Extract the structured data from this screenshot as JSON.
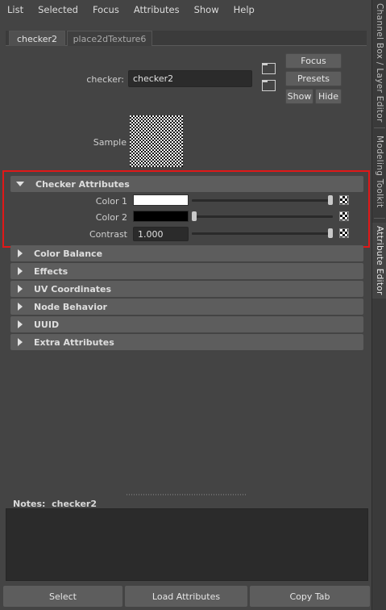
{
  "menu": [
    "List",
    "Selected",
    "Focus",
    "Attributes",
    "Show",
    "Help"
  ],
  "side_tabs": {
    "channel_box": "Channel Box / Layer Editor",
    "modeling_toolkit": "Modeling Toolkit",
    "attribute_editor": "Attribute Editor"
  },
  "node_tabs": [
    "checker2",
    "place2dTexture6"
  ],
  "node": {
    "label": "checker:",
    "name": "checker2"
  },
  "buttons": {
    "focus": "Focus",
    "presets": "Presets",
    "show": "Show",
    "hide": "Hide"
  },
  "sample_label": "Sample",
  "frames": {
    "checker": "Checker Attributes",
    "collapsed": [
      "Color Balance",
      "Effects",
      "UV Coordinates",
      "Node Behavior",
      "UUID",
      "Extra Attributes"
    ]
  },
  "attributes": {
    "color1": {
      "label": "Color 1",
      "color": "#ffffff",
      "slider": 1.0
    },
    "color2": {
      "label": "Color 2",
      "color": "#000000",
      "slider": 0.0
    },
    "contrast": {
      "label": "Contrast",
      "value": "1.000",
      "slider": 1.0
    }
  },
  "notes": {
    "label": "Notes:",
    "node": "checker2"
  },
  "bottom_buttons": {
    "select": "Select",
    "load": "Load Attributes",
    "copy": "Copy Tab"
  },
  "colors": {
    "highlight": "#e01818"
  }
}
